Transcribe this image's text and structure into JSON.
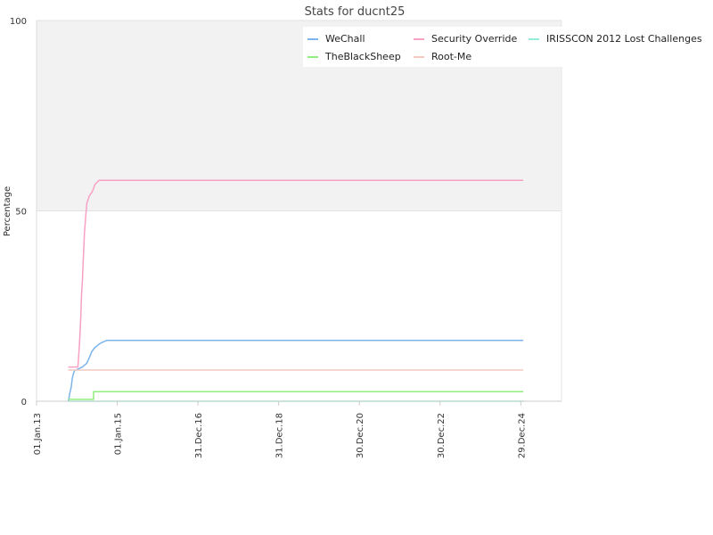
{
  "chart_data": {
    "type": "line",
    "title": "Stats for ducnt25",
    "ylabel": "Percentage",
    "xlabel": "",
    "ylim": [
      0,
      100
    ],
    "xlim": [
      "2013-01-01",
      "2026-01-01"
    ],
    "grid": true,
    "legend_position": "top-right",
    "y_ticks": [
      0,
      50,
      100
    ],
    "x_ticks": [
      {
        "label": "01.Jan.13",
        "date": "2013-01-01"
      },
      {
        "label": "01.Jan.15",
        "date": "2015-01-01"
      },
      {
        "label": "31.Dec.16",
        "date": "2016-12-31"
      },
      {
        "label": "31.Dec.18",
        "date": "2018-12-31"
      },
      {
        "label": "30.Dec.20",
        "date": "2020-12-30"
      },
      {
        "label": "30.Dec.22",
        "date": "2022-12-30"
      },
      {
        "label": "29.Dec.24",
        "date": "2024-12-29"
      }
    ],
    "series": [
      {
        "name": "WeChall",
        "color": "#7cb5ec",
        "points": [
          [
            "2013-10-15",
            0
          ],
          [
            "2013-10-22",
            1
          ],
          [
            "2013-10-28",
            2
          ],
          [
            "2013-11-05",
            3
          ],
          [
            "2013-11-12",
            4
          ],
          [
            "2013-11-20",
            6
          ],
          [
            "2013-11-28",
            7
          ],
          [
            "2013-12-10",
            8
          ],
          [
            "2014-01-15",
            8.5
          ],
          [
            "2014-02-20",
            9
          ],
          [
            "2014-04-01",
            10
          ],
          [
            "2014-05-01",
            12
          ],
          [
            "2014-05-15",
            13
          ],
          [
            "2014-06-10",
            14
          ],
          [
            "2014-07-20",
            15
          ],
          [
            "2014-08-20",
            15.5
          ],
          [
            "2014-09-30",
            16
          ],
          [
            "2025-01-20",
            16
          ]
        ]
      },
      {
        "name": "Security Override",
        "color": "#f7a1c4",
        "points": [
          [
            "2013-10-15",
            9
          ],
          [
            "2014-01-10",
            9
          ],
          [
            "2014-01-20",
            13
          ],
          [
            "2014-01-28",
            17
          ],
          [
            "2014-02-05",
            22
          ],
          [
            "2014-02-12",
            28
          ],
          [
            "2014-02-20",
            32
          ],
          [
            "2014-03-01",
            38
          ],
          [
            "2014-03-10",
            44
          ],
          [
            "2014-03-20",
            48
          ],
          [
            "2014-04-01",
            52
          ],
          [
            "2014-04-25",
            54
          ],
          [
            "2014-05-20",
            55
          ],
          [
            "2014-06-15",
            57
          ],
          [
            "2014-07-20",
            58
          ],
          [
            "2025-01-20",
            58
          ]
        ]
      },
      {
        "name": "IRISSCON 2012 Lost Challenges",
        "color": "#90eed9",
        "points": [
          [
            "2013-10-15",
            0
          ],
          [
            "2025-01-20",
            0
          ]
        ]
      },
      {
        "name": "TheBlackSheep",
        "color": "#90ed7d",
        "points": [
          [
            "2013-10-15",
            0.5
          ],
          [
            "2014-06-01",
            0.5
          ],
          [
            "2014-06-01",
            2.5
          ],
          [
            "2025-01-20",
            2.5
          ]
        ]
      },
      {
        "name": "Root-Me",
        "color": "#f4c8c0",
        "points": [
          [
            "2013-10-15",
            8.2
          ],
          [
            "2025-01-20",
            8.2
          ]
        ]
      }
    ]
  }
}
